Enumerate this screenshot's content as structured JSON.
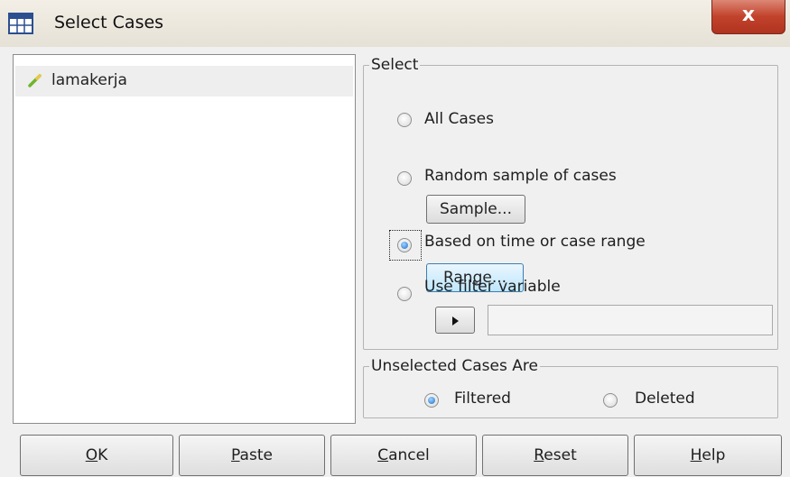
{
  "window": {
    "title": "Select Cases",
    "close_label": "x",
    "icon": "spss-dataset-icon"
  },
  "variables": {
    "items": [
      {
        "label": "lamakerja",
        "icon": "scale-variable-icon",
        "selected": true
      }
    ]
  },
  "select_group": {
    "legend": "Select",
    "options": [
      {
        "label": "All Cases",
        "checked": false
      },
      {
        "label": "Random sample of cases",
        "checked": false,
        "button": "Sample..."
      },
      {
        "label": "Based on time or case range",
        "checked": true,
        "button": "Range..."
      },
      {
        "label": "Use filter variable",
        "checked": false
      }
    ],
    "filter_arrow_icon": "move-right-arrow-icon",
    "filter_value": ""
  },
  "unselected_group": {
    "legend": "Unselected Cases Are",
    "options": [
      {
        "label": "Filtered",
        "checked": true
      },
      {
        "label": "Deleted",
        "checked": false
      }
    ]
  },
  "buttons": [
    {
      "label": "OK",
      "mnemonic": "O",
      "rest": "K"
    },
    {
      "label": "Paste",
      "mnemonic": "P",
      "rest": "aste"
    },
    {
      "label": "Cancel",
      "mnemonic": "C",
      "rest": "ancel"
    },
    {
      "label": "Reset",
      "mnemonic": "R",
      "rest": "eset"
    },
    {
      "label": "Help",
      "mnemonic": "H",
      "rest": "elp"
    }
  ],
  "colors": {
    "radio_checked": "#1f6fc9",
    "hover_button": "#bee6fd",
    "close_button": "#c2432c"
  }
}
